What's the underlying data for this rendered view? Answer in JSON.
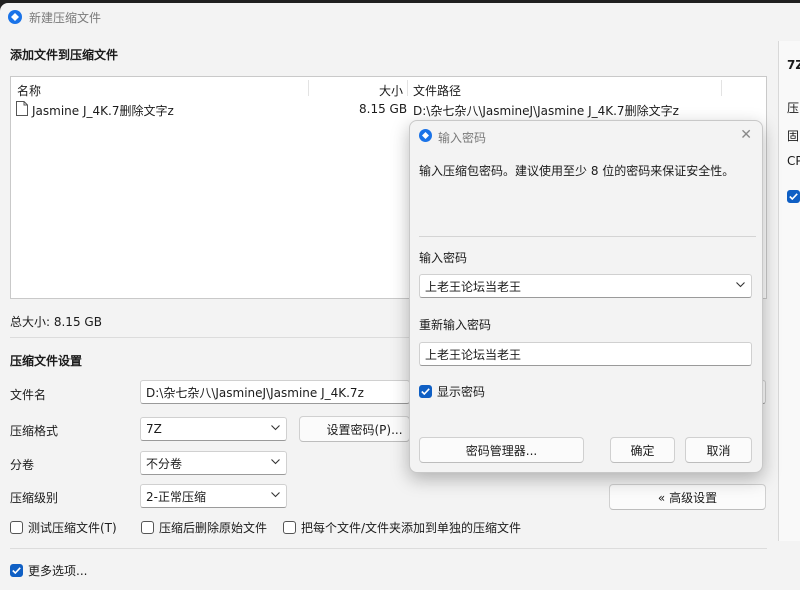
{
  "window": {
    "title": "新建压缩文件",
    "add_files_heading": "添加文件到压缩文件",
    "list_headers": {
      "name": "名称",
      "size": "大小",
      "path": "文件路径"
    },
    "files": [
      {
        "name": "Jasmine J_4K.7删除文字z",
        "size": "8.15 GB",
        "path": "D:\\杂七杂八\\JasmineJ\\Jasmine J_4K.7删除文字z"
      }
    ],
    "total_size": "总大小: 8.15 GB",
    "settings_heading": "压缩文件设置",
    "filename_label": "文件名",
    "filename_value": "D:\\杂七杂八\\JasmineJ\\Jasmine J_4K.7z",
    "format_label": "压缩格式",
    "format_value": "7Z",
    "set_password_button": "设置密码(P)...",
    "split_label": "分卷",
    "split_value": "不分卷",
    "level_label": "压缩级别",
    "level_value": "2-正常压缩",
    "advanced_button": "« 高级设置",
    "test_archive": "测试压缩文件(T)",
    "delete_after": "压缩后删除原始文件",
    "separate_archives": "把每个文件/文件夹添加到单独的压缩文件",
    "more_options": "更多选项..."
  },
  "right_panel": {
    "format_title": "7Z",
    "line1": "压",
    "line2": "固",
    "line3": "CP"
  },
  "dialog": {
    "title": "输入密码",
    "description": "输入压缩包密码。建议使用至少 8 位的密码来保证安全性。",
    "password_label": "输入密码",
    "password_value": "上老王论坛当老王",
    "reenter_label": "重新输入密码",
    "reenter_value": "上老王论坛当老王",
    "show_password": "显示密码",
    "manager_button": "密码管理器...",
    "ok_button": "确定",
    "cancel_button": "取消"
  },
  "colors": {
    "accent": "#0f5fc4",
    "window_bg": "#f3f3f3",
    "app_icon": "#1a73e8"
  }
}
